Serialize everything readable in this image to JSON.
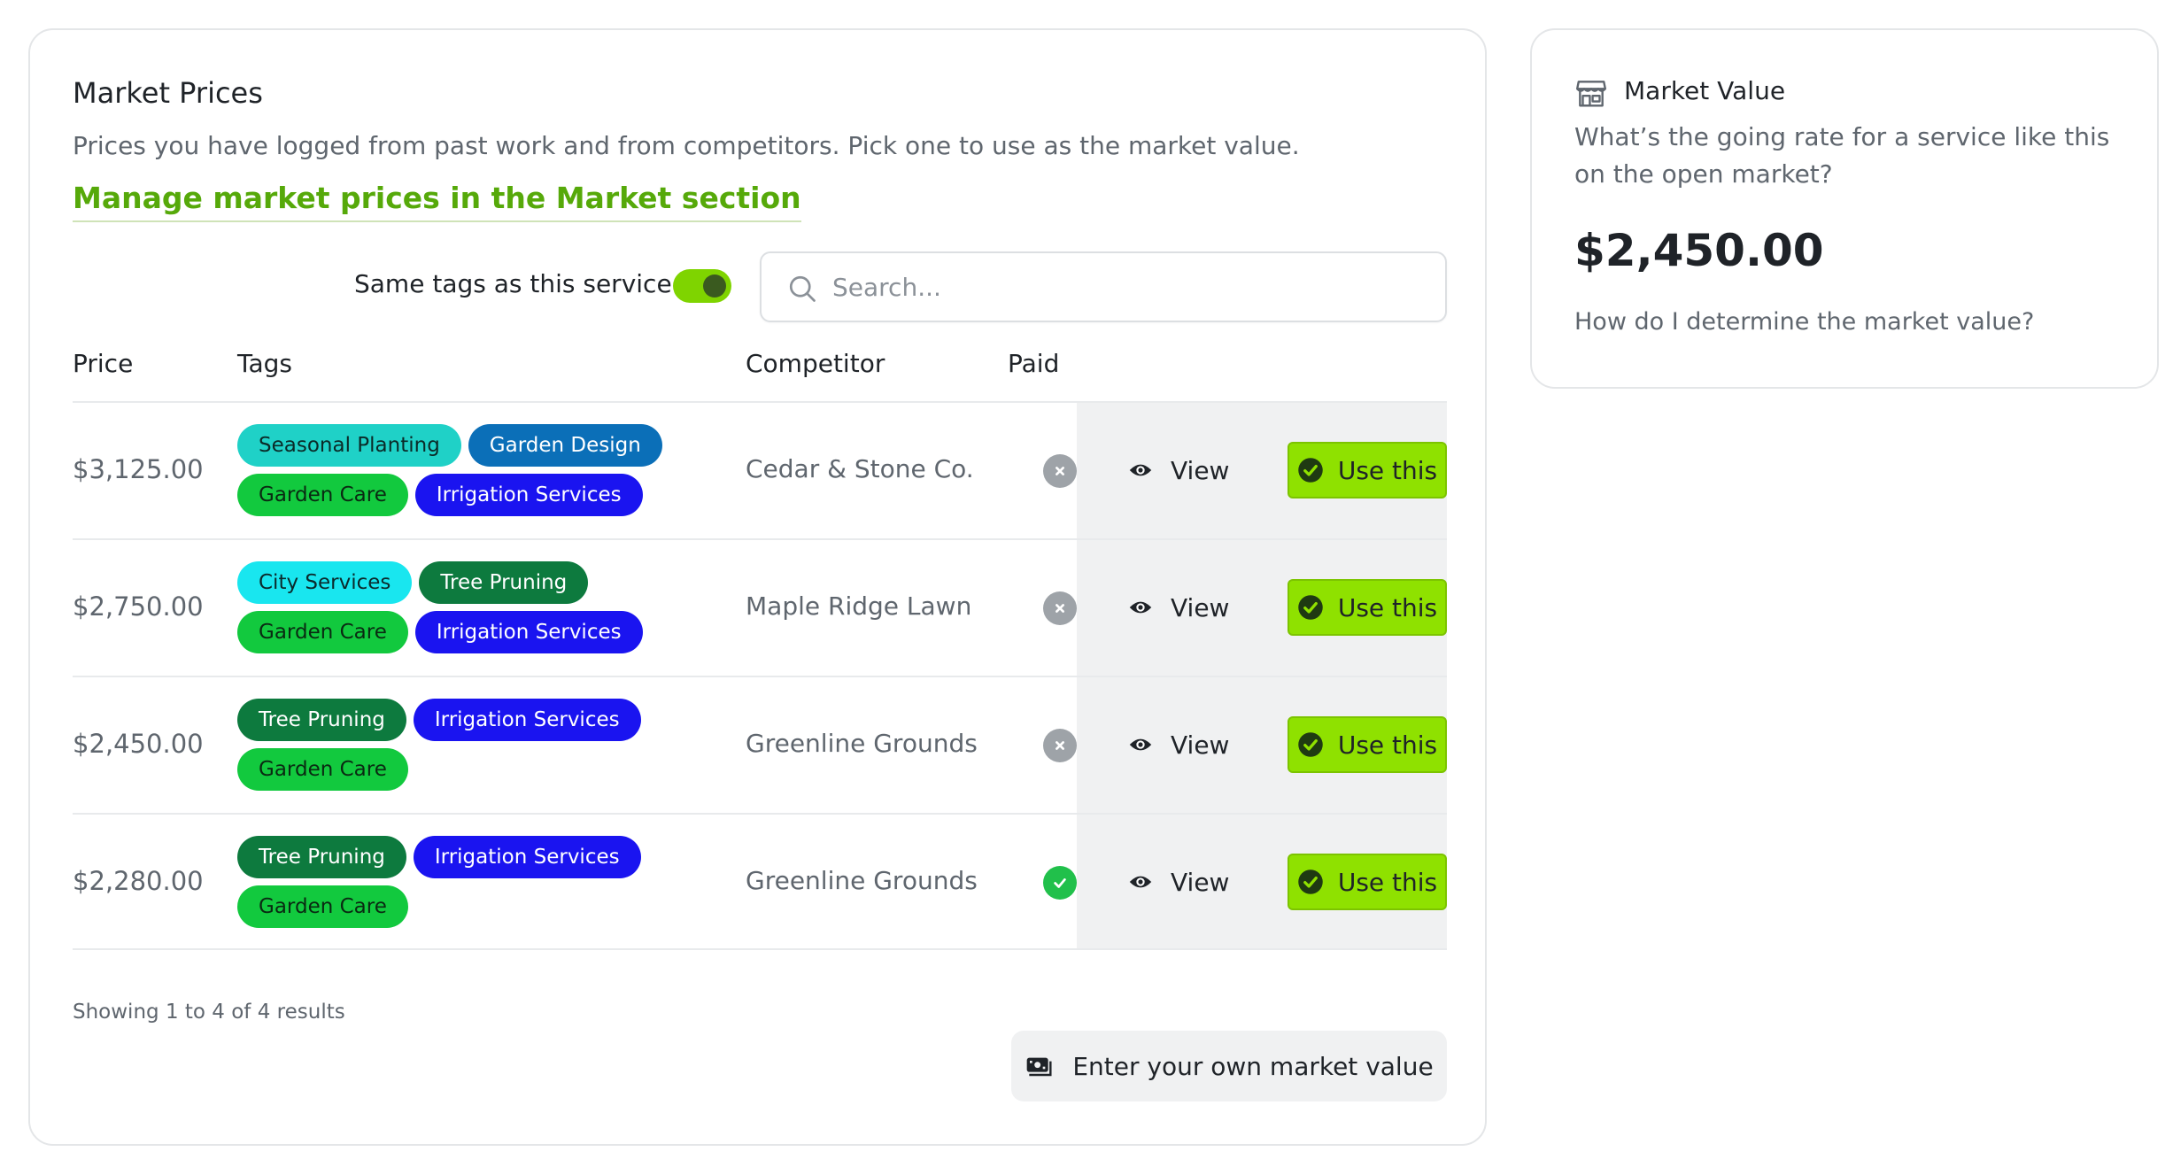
{
  "market_prices": {
    "title": "Market Prices",
    "description": "Prices you have logged from past work and from competitors. Pick one to use as the market value.",
    "manage_link": "Manage market prices in the Market section",
    "toggle_label": "Same tags as this service",
    "toggle_on": true,
    "search": {
      "placeholder": "Search...",
      "value": ""
    },
    "columns": {
      "price": "Price",
      "tags": "Tags",
      "competitor": "Competitor",
      "paid": "Paid"
    },
    "rows": [
      {
        "price": "$3,125.00",
        "tags": [
          [
            {
              "label": "Seasonal Planting",
              "color": "#1fd1c7",
              "text": "#0b2a28"
            },
            {
              "label": "Garden Design",
              "color": "#0b6fb8",
              "text": "#ffffff"
            }
          ],
          [
            {
              "label": "Garden Care",
              "color": "#12c93e",
              "text": "#0a2a12"
            },
            {
              "label": "Irrigation Services",
              "color": "#1a14f0",
              "text": "#ffffff"
            }
          ]
        ],
        "competitor": "Cedar & Stone Co.",
        "paid": false,
        "view_label": "View",
        "use_label": "Use this"
      },
      {
        "price": "$2,750.00",
        "tags": [
          [
            {
              "label": "City Services",
              "color": "#19e6ef",
              "text": "#0b2a2c"
            },
            {
              "label": "Tree Pruning",
              "color": "#0d7a3e",
              "text": "#ffffff"
            }
          ],
          [
            {
              "label": "Garden Care",
              "color": "#12c93e",
              "text": "#0a2a12"
            },
            {
              "label": "Irrigation Services",
              "color": "#1a14f0",
              "text": "#ffffff"
            }
          ]
        ],
        "competitor": "Maple Ridge Lawn",
        "paid": false,
        "view_label": "View",
        "use_label": "Use this"
      },
      {
        "price": "$2,450.00",
        "tags": [
          [
            {
              "label": "Tree Pruning",
              "color": "#0d7a3e",
              "text": "#ffffff"
            },
            {
              "label": "Irrigation Services",
              "color": "#1a14f0",
              "text": "#ffffff"
            }
          ],
          [
            {
              "label": "Garden Care",
              "color": "#12c93e",
              "text": "#0a2a12"
            }
          ]
        ],
        "competitor": "Greenline Grounds",
        "paid": false,
        "view_label": "View",
        "use_label": "Use this"
      },
      {
        "price": "$2,280.00",
        "tags": [
          [
            {
              "label": "Tree Pruning",
              "color": "#0d7a3e",
              "text": "#ffffff"
            },
            {
              "label": "Irrigation Services",
              "color": "#1a14f0",
              "text": "#ffffff"
            }
          ],
          [
            {
              "label": "Garden Care",
              "color": "#12c93e",
              "text": "#0a2a12"
            }
          ]
        ],
        "competitor": "Greenline Grounds",
        "paid": true,
        "view_label": "View",
        "use_label": "Use this"
      }
    ],
    "showing": "Showing 1 to 4 of 4 results",
    "enter_own_label": "Enter your own market value"
  },
  "market_value": {
    "icon": "storefront-icon",
    "title": "Market Value",
    "question": "What’s the going rate for a service like this on the open market?",
    "value": "$2,450.00",
    "help_link": "How do I determine the market value?"
  },
  "colors": {
    "accent": "#8fe100",
    "link": "#56a90a",
    "paid_yes": "#21c04b",
    "paid_no": "#9ea3a8"
  }
}
